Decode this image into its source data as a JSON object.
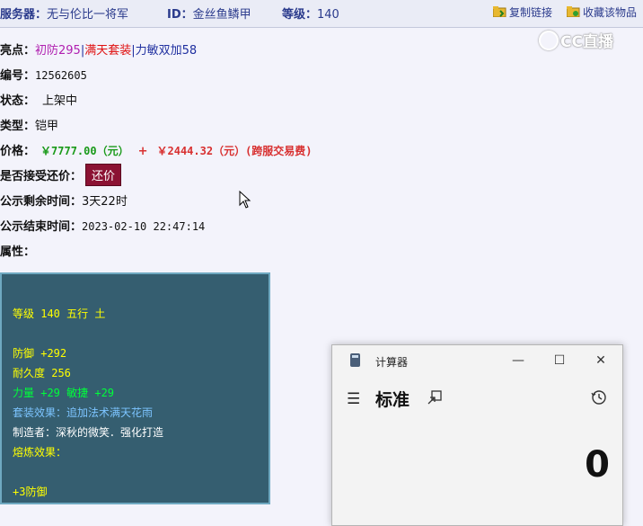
{
  "header": {
    "server_label": "服务器：",
    "server_value": "无与伦比一将军",
    "id_label": "ID：",
    "id_value": "金丝鱼鳞甲",
    "level_label": "等级：",
    "level_value": "140",
    "copy_link": "复制链接",
    "favorite": "收藏该物品"
  },
  "watermark": "CC直播",
  "item": {
    "highlight_label": "亮点：",
    "highlight_1": "初防295",
    "highlight_2": "满天套装",
    "highlight_3": "力敏双加58",
    "highlight_sep": "|",
    "number_label": "编号：",
    "number_value": "12562605",
    "status_label": "状态：",
    "status_value": "上架中",
    "type_label": "类型：",
    "type_value": "铠甲",
    "price_label": "价格：",
    "price_main": "￥7777.00（元）",
    "price_plus": "+",
    "price_fee": "￥2444.32（元）(跨服交易费)",
    "haggle_label": "是否接受还价：",
    "haggle_button": "还价",
    "remain_label": "公示剩余时间：",
    "remain_value": "3天22时",
    "end_label": "公示结束时间：",
    "end_value": "2023-02-10 22:47:14",
    "attr_label": "属性："
  },
  "attributes": {
    "level_line": "等级 140 五行 土",
    "defense": "防御 +292",
    "durability": "耐久度 256",
    "str_agi": "力量 +29 敏捷 +29",
    "set_effect": "套装效果：追加法术满天花雨",
    "maker": "制造者：深秋的微笑．强化打造",
    "refine": "熔炼效果：",
    "refine_value": "+3防御"
  },
  "calculator": {
    "title": "计算器",
    "mode": "标准",
    "display": "0",
    "minimize": "—",
    "maximize": "☐",
    "close": "✕",
    "menu_icon": "☰"
  },
  "colors": {
    "attr_bg": "#355e70",
    "attr_yellow": "#ffff00",
    "attr_green": "#00ff3a",
    "attr_blue": "#7cc4ff",
    "haggle_bg": "#8b1233"
  },
  "icons": [
    "folder-link-icon",
    "folder-star-icon",
    "calculator-app-icon",
    "menu-icon",
    "keep-on-top-icon",
    "history-icon",
    "mouse-cursor-icon"
  ]
}
